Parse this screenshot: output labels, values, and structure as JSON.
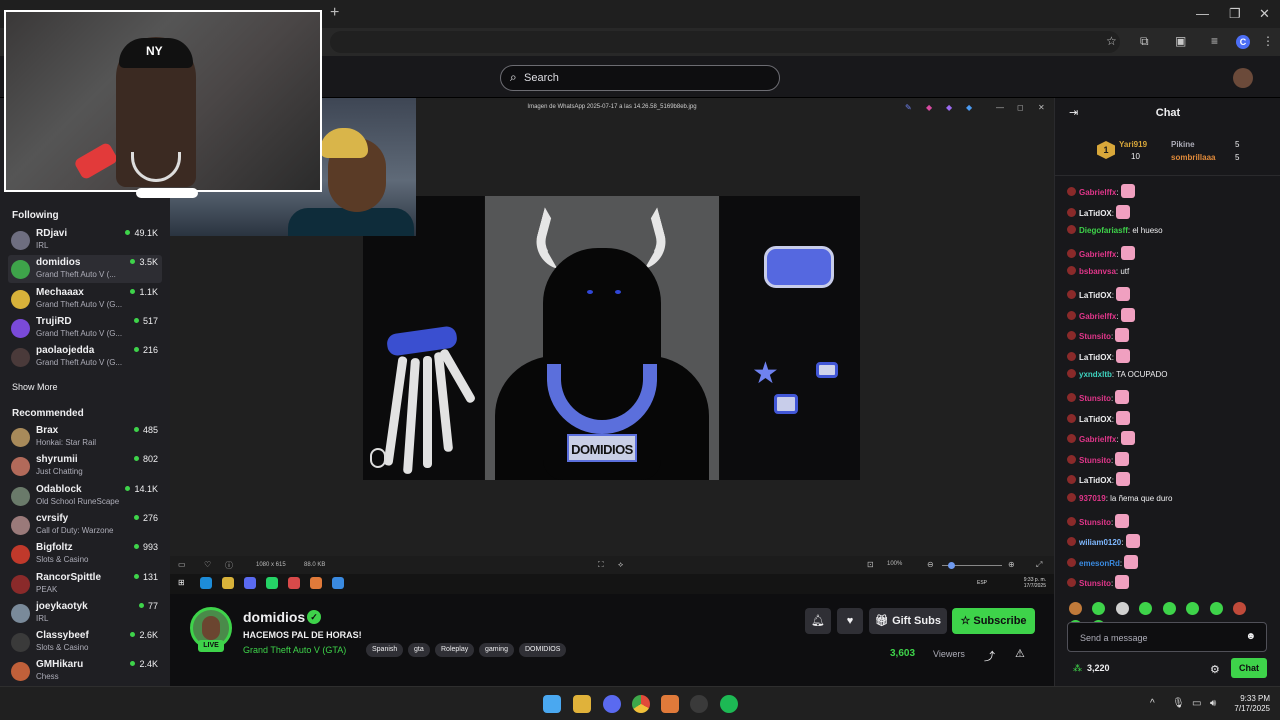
{
  "search": {
    "placeholder": "Search"
  },
  "sidebar": {
    "following_title": "Following",
    "following": [
      {
        "name": "RDjavi",
        "game": "IRL",
        "viewers": "49.1K",
        "color": "#6e6e80"
      },
      {
        "name": "domidios",
        "game": "Grand Theft Auto V (...",
        "viewers": "3.5K",
        "color": "#3ea34a",
        "active": true
      },
      {
        "name": "Mechaaax",
        "game": "Grand Theft Auto V (G...",
        "viewers": "1.1K",
        "color": "#d8b23a"
      },
      {
        "name": "TrujiRD",
        "game": "Grand Theft Auto V (G...",
        "viewers": "517",
        "color": "#7a4ad8"
      },
      {
        "name": "paolaojedda",
        "game": "Grand Theft Auto V (G...",
        "viewers": "216",
        "color": "#4a3a3a"
      }
    ],
    "show_more": "Show More",
    "recommended_title": "Recommended",
    "recommended": [
      {
        "name": "Brax",
        "game": "Honkai: Star Rail",
        "viewers": "485",
        "color": "#a88a5a"
      },
      {
        "name": "shyrumii",
        "game": "Just Chatting",
        "viewers": "802",
        "color": "#b26a5a"
      },
      {
        "name": "Odablock",
        "game": "Old School RuneScape",
        "viewers": "14.1K",
        "color": "#6a7a6a"
      },
      {
        "name": "cvrsify",
        "game": "Call of Duty: Warzone",
        "viewers": "276",
        "color": "#9a7a7a"
      },
      {
        "name": "Bigfoltz",
        "game": "Slots & Casino",
        "viewers": "993",
        "color": "#c0392b"
      },
      {
        "name": "RancorSpittle",
        "game": "PEAK",
        "viewers": "131",
        "color": "#8a2a2a"
      },
      {
        "name": "joeykaotyk",
        "game": "IRL",
        "viewers": "77",
        "color": "#7a8a9a"
      },
      {
        "name": "Classybeef",
        "game": "Slots & Casino",
        "viewers": "2.6K",
        "color": "#3a3a3a"
      },
      {
        "name": "GMHikaru",
        "game": "Chess",
        "viewers": "2.4K",
        "color": "#c0603a"
      }
    ]
  },
  "viewer": {
    "file_title": "Imagen de WhatsApp 2025-07-17 a las 14.26.58_5169b8eb.jpg",
    "pendant_text": "DOMIDIOS",
    "status_left": "1080 x 615",
    "status_size": "88.0 KB",
    "zoom": "100%",
    "lang": "ESP",
    "mini_time": "9:33 p. m.",
    "mini_date": "17/7/2025"
  },
  "stream": {
    "name": "domidios",
    "live": "LIVE",
    "title": "HACEMOS PAL DE HORAS!",
    "game": "Grand Theft Auto V (GTA)",
    "tags": [
      "Spanish",
      "gta",
      "Roleplay",
      "gaming",
      "DOMIDIOS"
    ],
    "gift_label": "Gift Subs",
    "subscribe_label": "Subscribe",
    "viewers": "3,603",
    "viewers_label": "Viewers"
  },
  "chat": {
    "title": "Chat",
    "leaderboard": {
      "rank": "1",
      "first": {
        "name": "Yari919",
        "count": "10"
      },
      "second": {
        "name": "Pikine",
        "count": "5"
      },
      "third": {
        "name": "sombrillaaa",
        "count": "5"
      }
    },
    "messages": [
      {
        "user": "Gabrielffx",
        "text": ":",
        "color": "#e0368a",
        "emote": true
      },
      {
        "user": "LaTidOX",
        "text": ":",
        "color": "#efeff1",
        "emote": true
      },
      {
        "user": "Diegofariasff",
        "text": ": el hueso",
        "color": "#3ed34a",
        "emote": false
      },
      {
        "user": "Gabrielffx",
        "text": ":",
        "color": "#e0368a",
        "emote": true
      },
      {
        "user": "bsbanvsa",
        "text": ": utf",
        "color": "#e0368a",
        "emote": false
      },
      {
        "user": "LaTidOX",
        "text": ":",
        "color": "#efeff1",
        "emote": true
      },
      {
        "user": "Gabrielffx",
        "text": ":",
        "color": "#e0368a",
        "emote": true
      },
      {
        "user": "Stunsito",
        "text": ":",
        "color": "#e0368a",
        "emote": true
      },
      {
        "user": "LaTidOX",
        "text": ":",
        "color": "#efeff1",
        "emote": true
      },
      {
        "user": "yxndxltb",
        "text": ": TA OCUPADO",
        "color": "#3ed3c0",
        "emote": false
      },
      {
        "user": "Stunsito",
        "text": ":",
        "color": "#e0368a",
        "emote": true
      },
      {
        "user": "LaTidOX",
        "text": ":",
        "color": "#efeff1",
        "emote": true
      },
      {
        "user": "Gabrielffx",
        "text": ":",
        "color": "#e0368a",
        "emote": true
      },
      {
        "user": "Stunsito",
        "text": ":",
        "color": "#e0368a",
        "emote": true
      },
      {
        "user": "LaTidOX",
        "text": ":",
        "color": "#efeff1",
        "emote": true
      },
      {
        "user": "937019",
        "text": ": la ñema que duro",
        "color": "#e0368a",
        "emote": false
      },
      {
        "user": "Stunsito",
        "text": ":",
        "color": "#e0368a",
        "emote": true
      },
      {
        "user": "wiliam0120",
        "text": ":",
        "color": "#7fb8ff",
        "emote": true
      },
      {
        "user": "emesonRd",
        "text": ":",
        "color": "#3a8ae0",
        "emote": true
      },
      {
        "user": "Stunsito",
        "text": ":",
        "color": "#e0368a",
        "emote": true
      }
    ],
    "input_placeholder": "Send a message",
    "points": "3,220",
    "chat_button": "Chat"
  },
  "taskbar": {
    "time": "9:33 PM",
    "date": "7/17/2025"
  },
  "colors": {
    "accent": "#3ed34a",
    "bg": "#0e0e10",
    "panel": "#18181b"
  }
}
